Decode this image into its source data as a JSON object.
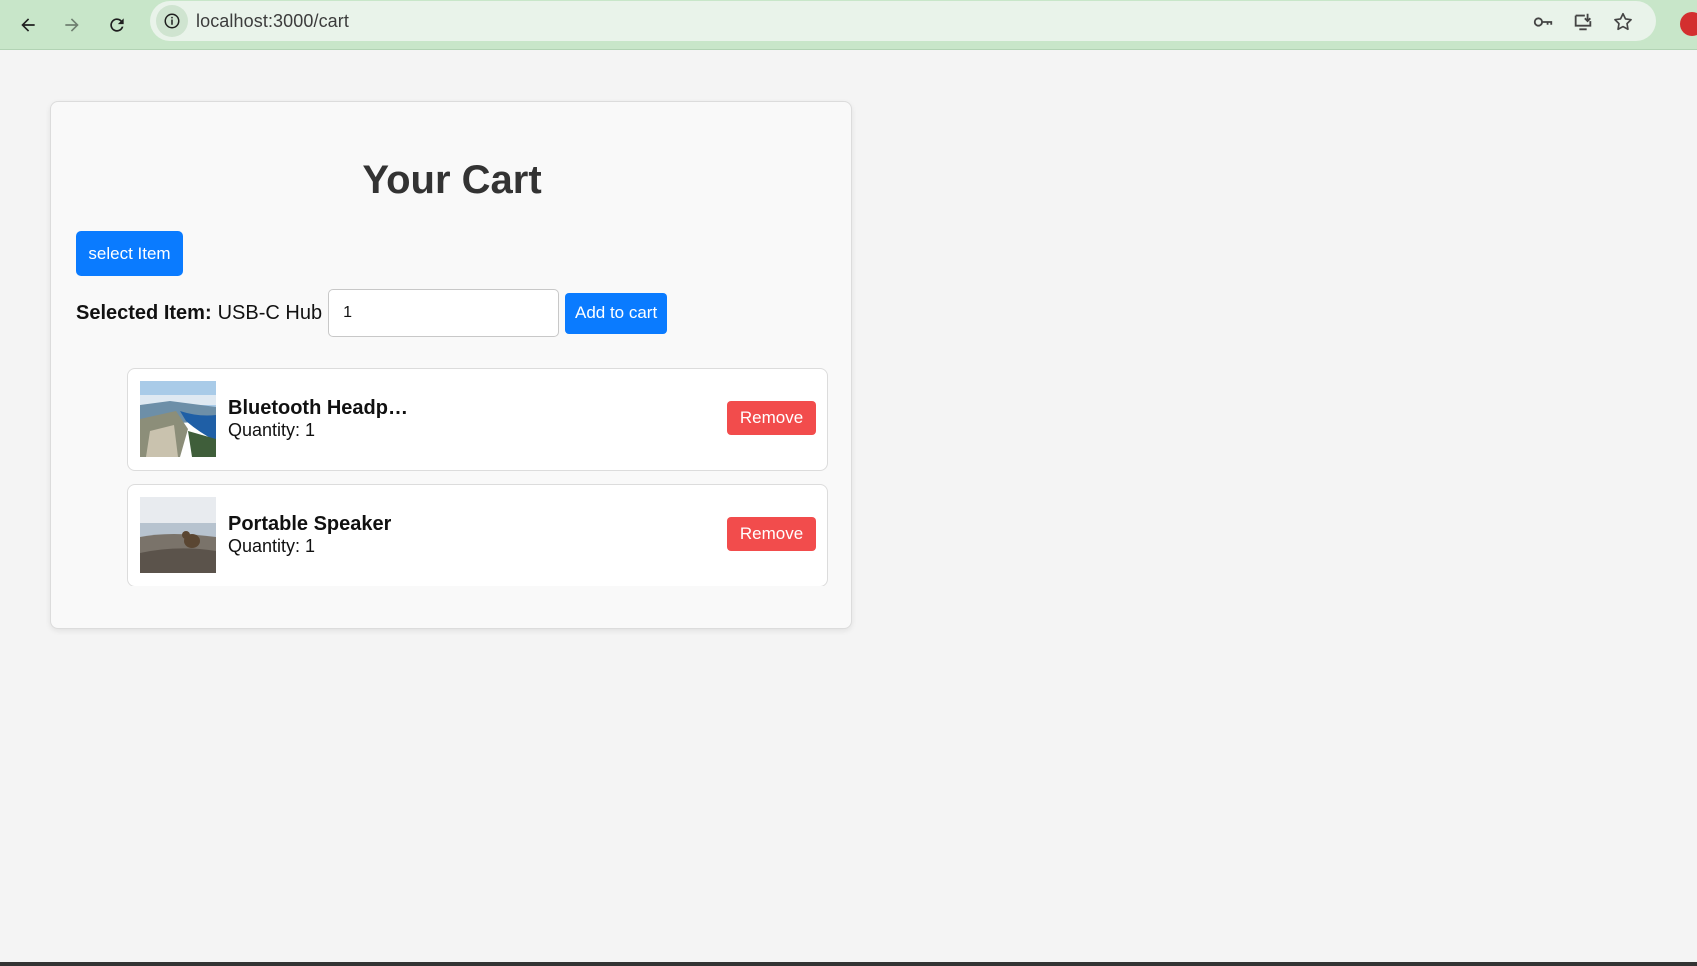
{
  "browser": {
    "url": "localhost:3000/cart",
    "icons": [
      "back-arrow-icon",
      "forward-arrow-icon",
      "reload-icon",
      "info-icon",
      "key-icon",
      "install-icon",
      "star-icon",
      "extension-icon"
    ]
  },
  "page": {
    "title": "Your Cart",
    "select_button_label": "select Item",
    "selected_label": "Selected Item:",
    "selected_value": "USB-C Hub",
    "quantity_value": "1",
    "add_button_label": "Add to cart"
  },
  "cart_items": [
    {
      "name": "Bluetooth Headphones",
      "quantity": "Quantity: 1",
      "remove_label": "Remove",
      "thumb": "fjord-landscape-photo"
    },
    {
      "name": "Portable Speaker",
      "quantity": "Quantity: 1",
      "remove_label": "Remove",
      "thumb": "marmot-on-rocks-photo"
    }
  ],
  "colors": {
    "chrome_bg": "#c8e6c9",
    "primary_button": "#0a7bff",
    "remove_button": "#f24c4c",
    "page_bg": "#f4f4f4"
  }
}
